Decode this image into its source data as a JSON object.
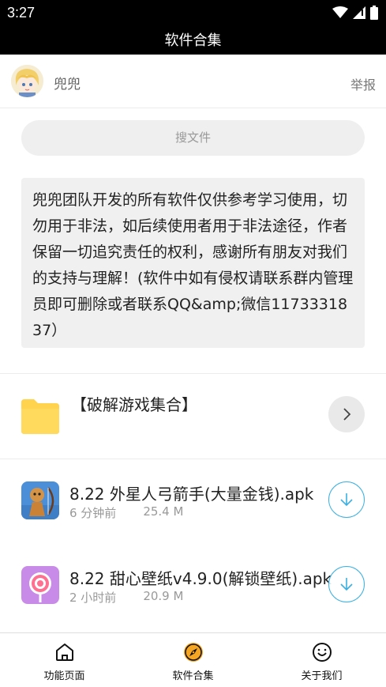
{
  "status_bar": {
    "time": "3:27"
  },
  "header": {
    "title": "软件合集"
  },
  "author": {
    "name": "兜兜",
    "report_label": "举报"
  },
  "search": {
    "placeholder": "搜文件"
  },
  "notice": {
    "text": "兜兜团队开发的所有软件仅供参考学习使用，切勿用于非法，如后续使用者用于非法途径，作者保留一切追究责任的权利，感谢所有朋友对我们的支持与理解！(软件中如有侵权请联系群内管理员即可删除或者联系QQ&amp;微信1173331837）"
  },
  "folder": {
    "title": "【破解游戏集合】",
    "icon": "folder-icon",
    "color": "#FFD34E"
  },
  "files": [
    {
      "name": "8.22 外星人弓箭手(大量金钱).apk",
      "time": "6 分钟前",
      "size": "25.4 M"
    },
    {
      "name": "8.22 甜心壁纸v4.9.0(解锁壁纸).apk",
      "time": "2 小时前",
      "size": "20.9 M"
    }
  ],
  "tabs": [
    {
      "label": "功能页面",
      "icon": "home-icon"
    },
    {
      "label": "软件合集",
      "icon": "compass-icon",
      "active": true
    },
    {
      "label": "关于我们",
      "icon": "smile-icon"
    }
  ],
  "colors": {
    "accent": "#3AB0E2",
    "active_tab": "#F5A623"
  }
}
